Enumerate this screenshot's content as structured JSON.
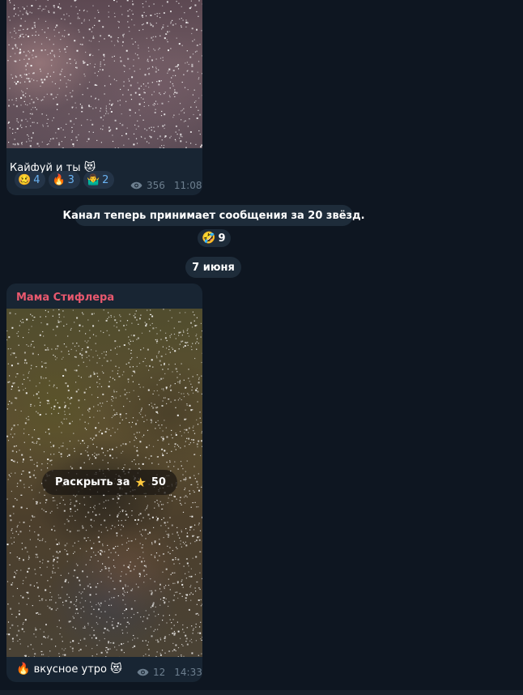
{
  "messages": [
    {
      "caption_text": "Кайфуй и ты",
      "caption_emoji": "😻",
      "reactions": [
        {
          "emoji": "🥴",
          "count": "4"
        },
        {
          "emoji": "🔥",
          "count": "3"
        },
        {
          "emoji": "🤷‍♂️",
          "count": "2"
        }
      ],
      "views": "356",
      "time": "11:08"
    },
    {
      "sender": "Мама Стифлера",
      "reveal_label": "Раскрыть за",
      "reveal_price": "50",
      "caption_emoji_before": "🔥",
      "caption_text": "вкусное утро",
      "caption_emoji_after": "😻",
      "views": "12",
      "time": "14:33"
    }
  ],
  "service_message": {
    "text": "Канал теперь принимает сообщения за 20 звёзд.",
    "reaction_emoji": "🤣",
    "reaction_count": "9"
  },
  "date_separator": "7 июня",
  "icons": {
    "views": "eye-icon",
    "price": "star-icon"
  },
  "colors": {
    "background": "#0e1621",
    "bubble": "#182533",
    "sender_name": "#e9586e",
    "reaction_count": "#6ab3f3",
    "meta": "#6d7f8f",
    "star": "#ffc83d"
  }
}
